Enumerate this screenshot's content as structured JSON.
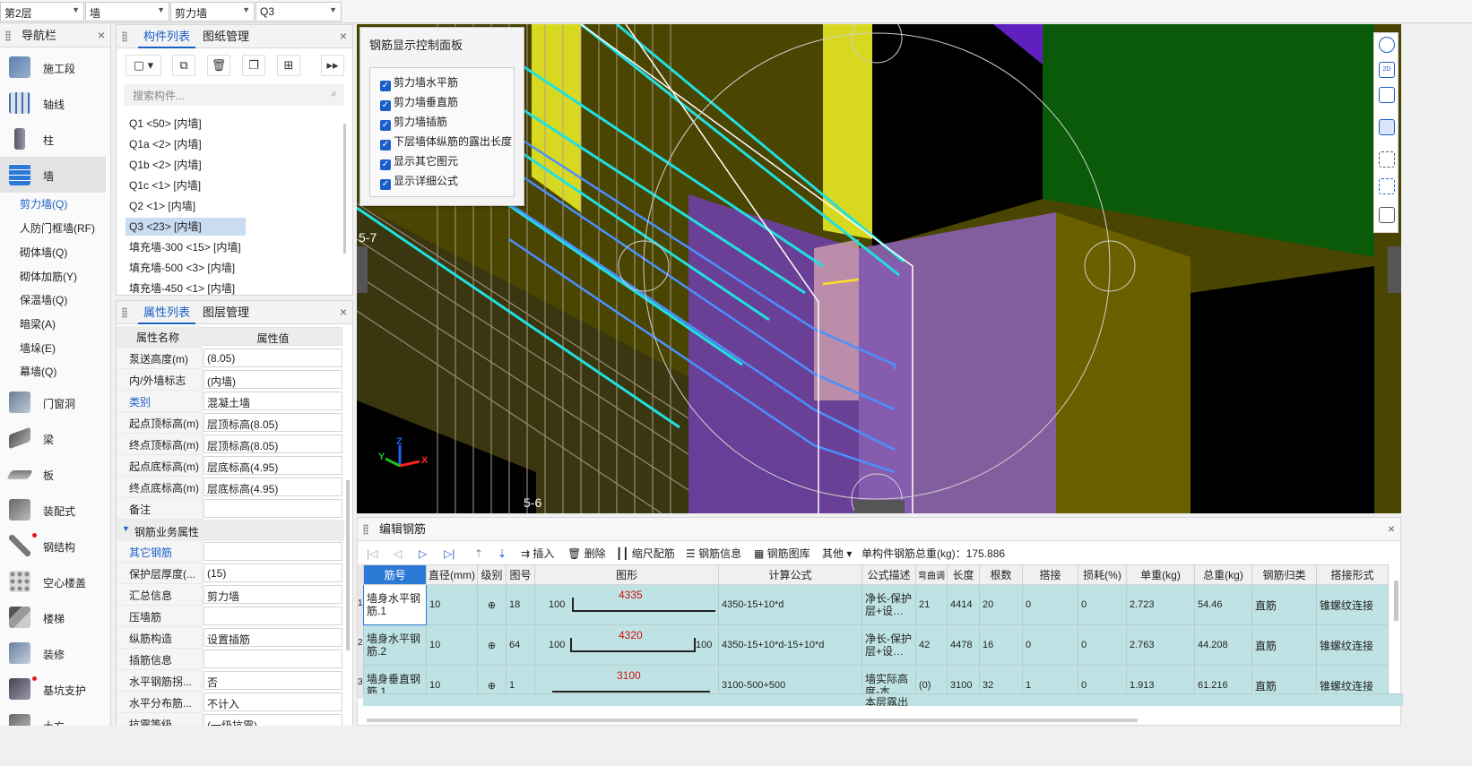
{
  "topbar": {
    "floor": "第2层",
    "category": "墙",
    "type": "剪力墙",
    "component": "Q3"
  },
  "nav": {
    "title": "导航栏",
    "items": [
      {
        "label": "施工段",
        "icon": "construction-segment-icon"
      },
      {
        "label": "轴线",
        "icon": "grid-axis-icon"
      },
      {
        "label": "柱",
        "icon": "column-icon"
      },
      {
        "label": "墙",
        "icon": "wall-icon"
      },
      {
        "label": "门窗洞",
        "icon": "door-window-icon"
      },
      {
        "label": "梁",
        "icon": "beam-icon"
      },
      {
        "label": "板",
        "icon": "slab-icon"
      },
      {
        "label": "装配式",
        "icon": "prefab-icon"
      },
      {
        "label": "钢结构",
        "icon": "steel-structure-icon"
      },
      {
        "label": "空心楼盖",
        "icon": "hollow-floor-icon"
      },
      {
        "label": "楼梯",
        "icon": "stair-icon"
      },
      {
        "label": "装修",
        "icon": "decoration-icon"
      },
      {
        "label": "基坑支护",
        "icon": "pit-support-icon"
      },
      {
        "label": "土方",
        "icon": "earthwork-icon"
      }
    ],
    "wall_subitems": [
      "剪力墙(Q)",
      "人防门框墙(RF)",
      "砌体墙(Q)",
      "砌体加筋(Y)",
      "保温墙(Q)",
      "暗梁(A)",
      "墙垛(E)",
      "幕墙(Q)"
    ]
  },
  "components": {
    "tab_active": "构件列表",
    "tab_other": "图纸管理",
    "search_placeholder": "搜索构件...",
    "items": [
      "Q1 <50> [内墙]",
      "Q1a <2> [内墙]",
      "Q1b <2> [内墙]",
      "Q1c <1> [内墙]",
      "Q2 <1> [内墙]",
      "Q3 <23> [内墙]",
      "填充墙-300 <15> [内墙]",
      "填充墙-500 <3> [内墙]",
      "填充墙-450 <1> [内墙]"
    ]
  },
  "properties": {
    "tab_active": "属性列表",
    "tab_other": "图层管理",
    "header_name": "属性名称",
    "header_value": "属性值",
    "rows": [
      {
        "name": "泵送高度(m)",
        "value": "(8.05)"
      },
      {
        "name": "内/外墙标志",
        "value": "(内墙)"
      },
      {
        "name": "类别",
        "value": "混凝土墙"
      },
      {
        "name": "起点顶标高(m)",
        "value": "层顶标高(8.05)"
      },
      {
        "name": "终点顶标高(m)",
        "value": "层顶标高(8.05)"
      },
      {
        "name": "起点底标高(m)",
        "value": "层底标高(4.95)"
      },
      {
        "name": "终点底标高(m)",
        "value": "层底标高(4.95)"
      },
      {
        "name": "备注",
        "value": ""
      }
    ],
    "group": "钢筋业务属性",
    "rebar_rows": [
      {
        "name": "其它钢筋",
        "value": ""
      },
      {
        "name": "保护层厚度(...",
        "value": "(15)"
      },
      {
        "name": "汇总信息",
        "value": "剪力墙"
      },
      {
        "name": "压墙筋",
        "value": ""
      },
      {
        "name": "纵筋构造",
        "value": "设置插筋"
      },
      {
        "name": "插筋信息",
        "value": ""
      },
      {
        "name": "水平钢筋拐...",
        "value": "否"
      },
      {
        "name": "水平分布筋...",
        "value": "不计入"
      },
      {
        "name": "抗震等级",
        "value": "(一级抗震)"
      }
    ]
  },
  "control_panel": {
    "title": "钢筋显示控制面板",
    "options": [
      "剪力墙水平筋",
      "剪力墙垂直筋",
      "剪力墙插筋",
      "下层墙体纵筋的露出长度",
      "显示其它图元",
      "显示详细公式"
    ]
  },
  "viewport": {
    "label_a": "5-7",
    "label_b": "5-6",
    "axis_x": "X",
    "axis_y": "Y",
    "axis_z": "Z"
  },
  "edit_rebar": {
    "title": "编辑钢筋",
    "toolbar": {
      "insert": "插入",
      "delete": "删除",
      "scale": "缩尺配筋",
      "info": "钢筋信息",
      "library": "钢筋图库",
      "other": "其他",
      "total": "单构件钢筋总重(kg)：175.886"
    },
    "columns": [
      "筋号",
      "直径(mm)",
      "级别",
      "图号",
      "图形",
      "计算公式",
      "公式描述",
      "弯曲调",
      "长度",
      "根数",
      "搭接",
      "损耗(%)",
      "单重(kg)",
      "总重(kg)",
      "钢筋归类",
      "搭接形式"
    ],
    "rows": [
      {
        "idx": "1",
        "name": "墙身水平钢筋.1",
        "dia": "10",
        "grade": "⊕",
        "fig": "18",
        "shape_left": "100",
        "shape_mid": "4335",
        "shape_right": "",
        "formula": "4350-15+10*d",
        "desc": "净长-保护层+设…",
        "bend": "21",
        "len": "4414",
        "count": "20",
        "lap": "0",
        "loss": "0",
        "unit": "2.723",
        "total": "54.46",
        "cls": "直筋",
        "lapform": "锥螺纹连接"
      },
      {
        "idx": "2",
        "name": "墙身水平钢筋.2",
        "dia": "10",
        "grade": "⊕",
        "fig": "64",
        "shape_left": "100",
        "shape_mid": "4320",
        "shape_right": "100",
        "formula": "4350-15+10*d-15+10*d",
        "desc": "净长-保护层+设…",
        "bend": "42",
        "len": "4478",
        "count": "16",
        "lap": "0",
        "loss": "0",
        "unit": "2.763",
        "total": "44.208",
        "cls": "直筋",
        "lapform": "锥螺纹连接"
      },
      {
        "idx": "3",
        "name": "墙身垂直钢筋.1",
        "dia": "10",
        "grade": "⊕",
        "fig": "1",
        "shape_left": "",
        "shape_mid": "3100",
        "shape_right": "",
        "formula": "3100-500+500",
        "desc": "墙实际高度-本…",
        "bend": "(0)",
        "len": "3100",
        "count": "32",
        "lap": "1",
        "loss": "0",
        "unit": "1.913",
        "total": "61.216",
        "cls": "直筋",
        "lapform": "锥螺纹连接"
      }
    ],
    "partial_row_desc": "本层露出"
  }
}
